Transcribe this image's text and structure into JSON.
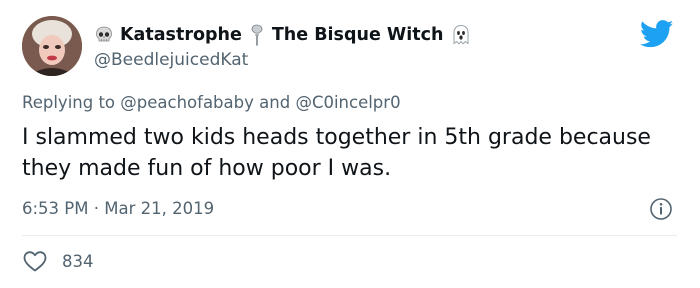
{
  "author": {
    "name_part1": "Katastrophe",
    "name_part2": "The Bisque Witch",
    "emoji_left": "skull-icon",
    "emoji_middle": "pin-icon",
    "emoji_right": "ghost-icon",
    "handle": "@BeedlejuicedKat"
  },
  "reply": {
    "prefix": "Replying to",
    "mention1": "@peachofababy",
    "connector": "and",
    "mention2": "@C0incelpr0"
  },
  "tweet": {
    "text": "I slammed two kids heads together in 5th grade because they made fun of how poor I was.",
    "time": "6:53 PM",
    "separator": "·",
    "date": "Mar 21, 2019"
  },
  "engagement": {
    "likes": "834"
  },
  "icons": {
    "brand": "twitter-bird-icon",
    "info": "info-icon",
    "like": "heart-icon"
  },
  "colors": {
    "brand_blue": "#1da1f2",
    "secondary_text": "#536471",
    "primary_text": "#0f1419",
    "divider": "#e6ecf0"
  }
}
